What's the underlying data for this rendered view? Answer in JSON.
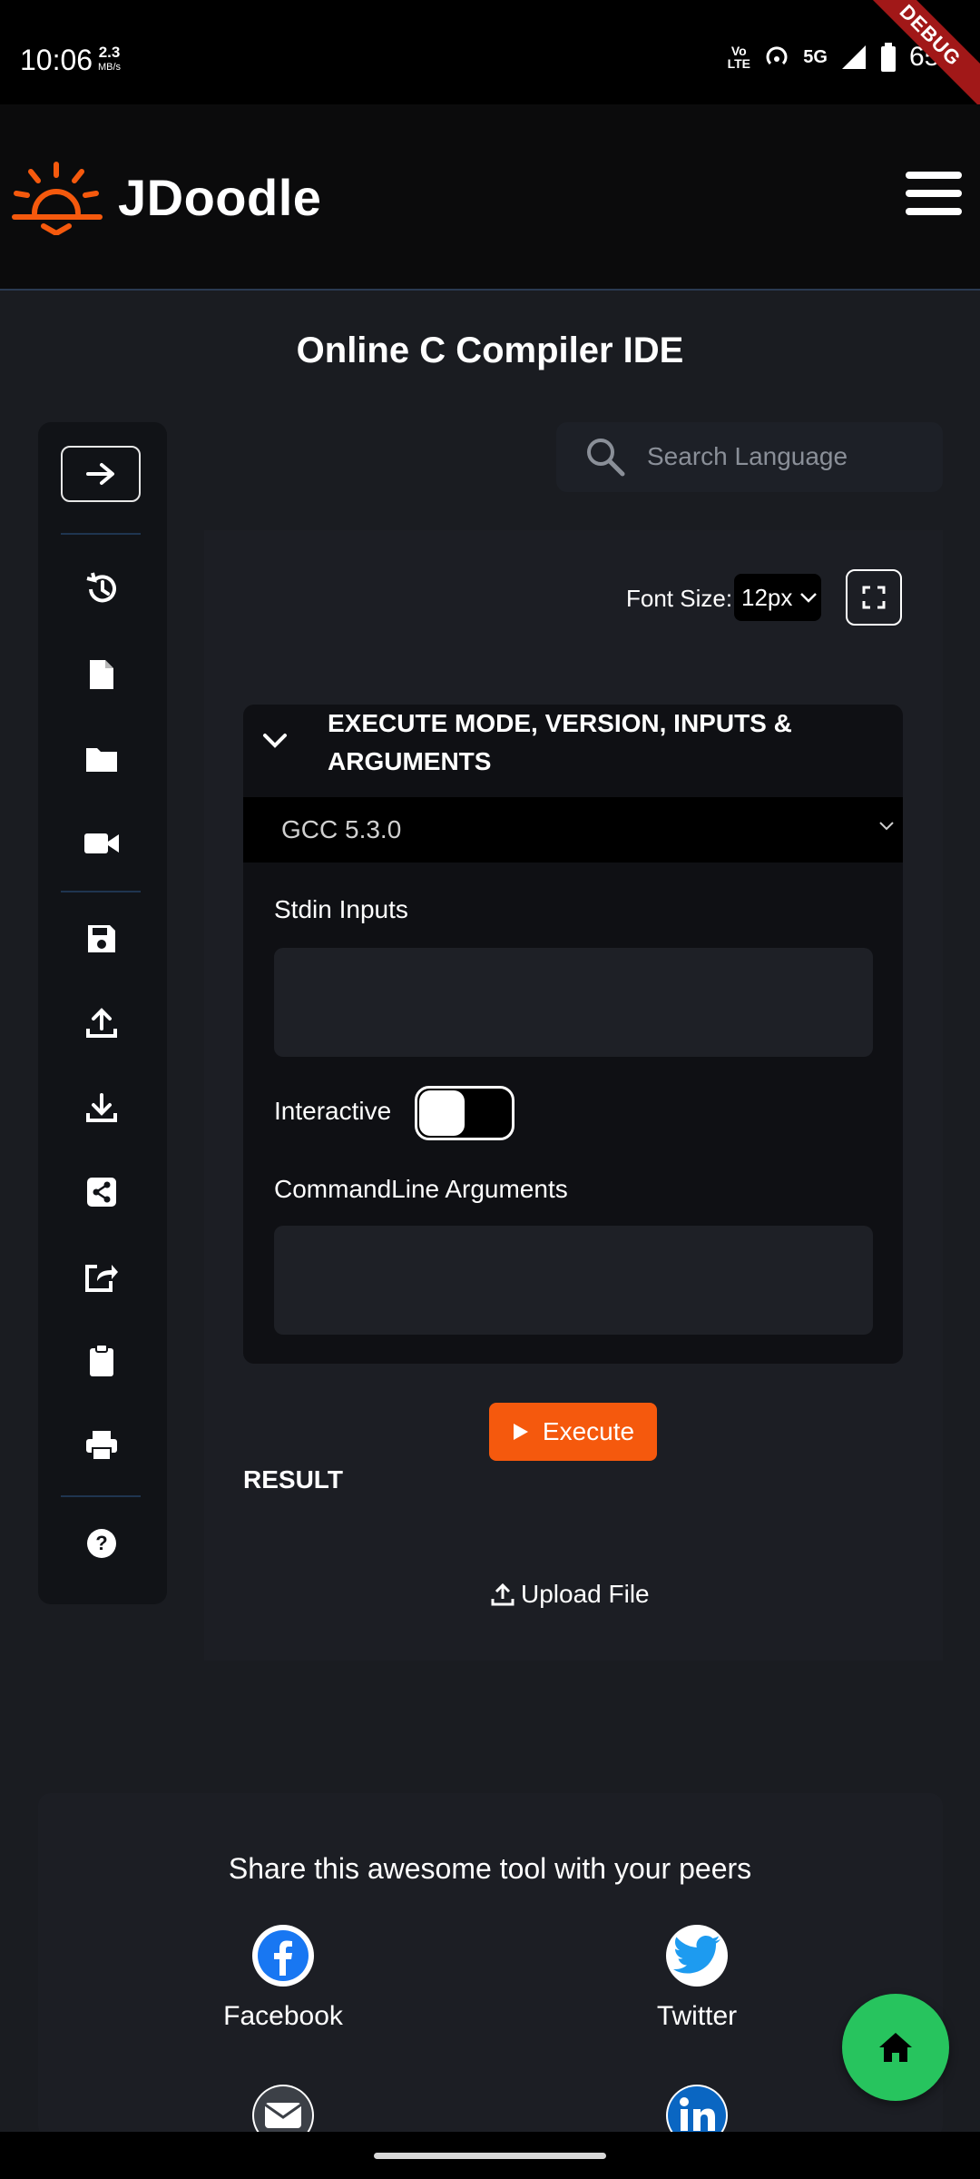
{
  "status_bar": {
    "time": "10:06",
    "speed_value": "2.3",
    "speed_unit": "MB/s",
    "network": "5G",
    "volte": "Vo LTE",
    "battery": "65%",
    "debug_ribbon": "DEBUG"
  },
  "header": {
    "brand": "JDoodle",
    "menu_icon": "hamburger-icon",
    "accent_color": "#f5590d"
  },
  "page": {
    "title": "Online C Compiler IDE"
  },
  "toolbar": {
    "icons": [
      "arrow-right-icon",
      "history-icon",
      "file-icon",
      "folder-icon",
      "video-icon",
      "save-icon",
      "upload-icon",
      "download-icon",
      "share-icon",
      "export-icon",
      "clipboard-icon",
      "print-icon",
      "help-icon"
    ]
  },
  "search": {
    "placeholder": "Search Language"
  },
  "editor": {
    "font_size_label": "Font Size:",
    "font_size_value": "12px"
  },
  "options": {
    "title": "EXECUTE MODE, VERSION, INPUTS & ARGUMENTS",
    "version": "GCC 5.3.0",
    "stdin_label": "Stdin Inputs",
    "interactive_label": "Interactive",
    "cmd_label": "CommandLine Arguments"
  },
  "actions": {
    "execute_label": "Execute",
    "result_label": "RESULT",
    "upload_label": "Upload File"
  },
  "share": {
    "title": "Share this awesome tool with your peers",
    "items": [
      {
        "label": "Facebook",
        "icon": "facebook-icon"
      },
      {
        "label": "Twitter",
        "icon": "twitter-icon"
      },
      {
        "label": "",
        "icon": "email-icon"
      },
      {
        "label": "",
        "icon": "linkedin-icon"
      }
    ]
  },
  "fab": {
    "icon": "home-icon",
    "color": "#27c45e"
  }
}
